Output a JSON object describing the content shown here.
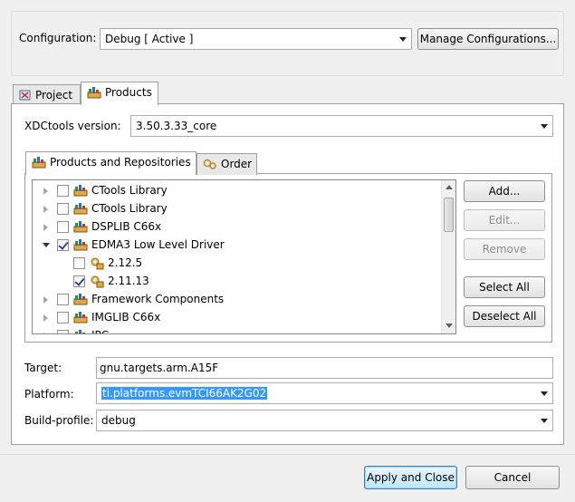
{
  "config": {
    "label": "Configuration:",
    "value": "Debug  [ Active ]",
    "manage_label": "Manage Configurations..."
  },
  "tabs": [
    {
      "label": "Project",
      "icon": "project-icon"
    },
    {
      "label": "Products",
      "icon": "products-icon",
      "active": true
    }
  ],
  "xdc": {
    "label": "XDCtools version:",
    "value": "3.50.3.33_core"
  },
  "inner_tabs": [
    {
      "label": "Products and Repositories",
      "icon": "products-icon",
      "active": true
    },
    {
      "label": "Order",
      "icon": "order-icon"
    }
  ],
  "tree": [
    {
      "label": "CTools Library",
      "level": 0,
      "expander": "collapsed",
      "checked": false,
      "icon": "package-icon"
    },
    {
      "label": "CTools Library",
      "level": 0,
      "expander": "collapsed",
      "checked": false,
      "icon": "package-icon"
    },
    {
      "label": "DSPLIB C66x",
      "level": 0,
      "expander": "collapsed",
      "checked": false,
      "icon": "package-icon"
    },
    {
      "label": "EDMA3 Low Level Driver",
      "level": 0,
      "expander": "expanded",
      "checked": true,
      "icon": "package-icon"
    },
    {
      "label": "2.12.5",
      "level": 1,
      "expander": "none",
      "checked": false,
      "icon": "version-gear-icon"
    },
    {
      "label": "2.11.13",
      "level": 1,
      "expander": "none",
      "checked": true,
      "icon": "version-gear-icon"
    },
    {
      "label": "Framework Components",
      "level": 0,
      "expander": "collapsed",
      "checked": false,
      "icon": "package-icon"
    },
    {
      "label": "IMGLIB C66x",
      "level": 0,
      "expander": "collapsed",
      "checked": false,
      "icon": "package-icon"
    },
    {
      "label": "IPC",
      "level": 0,
      "expander": "collapsed",
      "checked": false,
      "icon": "package-icon"
    }
  ],
  "side_buttons": {
    "add": "Add...",
    "edit": "Edit...",
    "remove": "Remove",
    "select_all": "Select All",
    "deselect_all": "Deselect All"
  },
  "target": {
    "label": "Target:",
    "value": "gnu.targets.arm.A15F"
  },
  "platform": {
    "label": "Platform:",
    "value": "ti.platforms.evmTCI66AK2G02"
  },
  "build_profile": {
    "label": "Build-profile:",
    "value": "debug"
  },
  "footer": {
    "apply_close": "Apply and Close",
    "cancel": "Cancel"
  },
  "colors": {
    "selection": "#3399ff",
    "panel_bg": "#ffffff",
    "window_bg": "#f0f0f0"
  }
}
